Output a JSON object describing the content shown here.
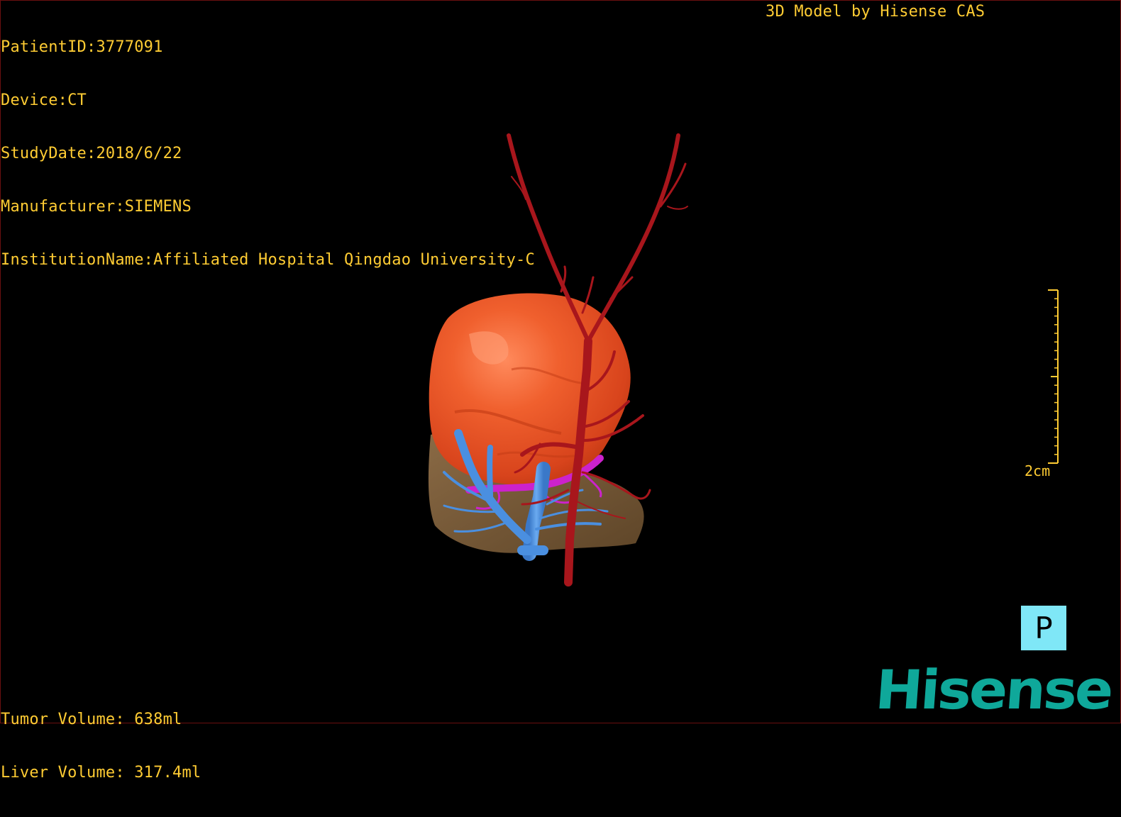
{
  "patient_info": {
    "patient_id": "PatientID:3777091",
    "device": "Device:CT",
    "study_date": "StudyDate:2018/6/22",
    "manufacturer": "Manufacturer:SIEMENS",
    "institution": "InstitutionName:Affiliated Hospital Qingdao University-C"
  },
  "model_credit": "3D Model by Hisense CAS",
  "volumes": {
    "tumor": "Tumor Volume: 638ml",
    "liver": "Liver Volume: 317.4ml"
  },
  "scale": {
    "label": "2cm"
  },
  "orientation": {
    "label": "P"
  },
  "brand": {
    "name": "Hisense"
  },
  "colors": {
    "text": "#ffcc33",
    "tumor": "#e8522a",
    "artery": "#a8161c",
    "portal_vein": "#4a8fe0",
    "hepatic_vein": "#cc22cc",
    "liver": "#7a5d3a",
    "orientation_bg": "#7fe7f7",
    "brand": "#0fa89a"
  }
}
